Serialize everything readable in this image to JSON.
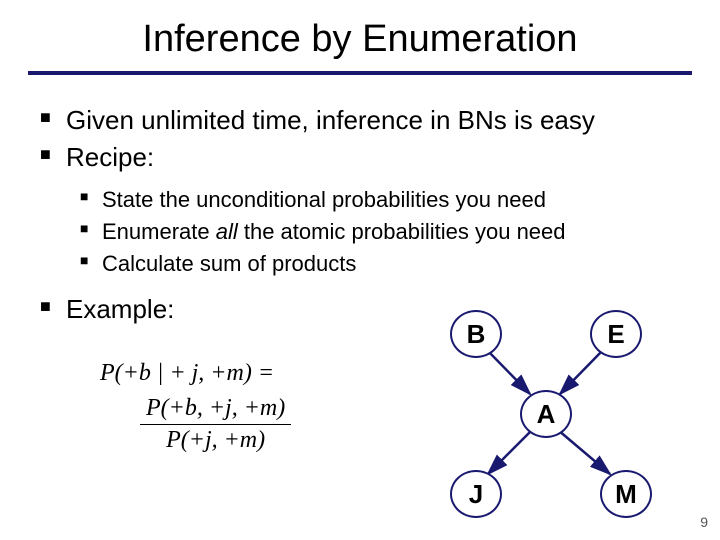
{
  "title": "Inference by Enumeration",
  "bullets": {
    "b1_1": "Given unlimited time, inference in BNs is easy",
    "b1_2": "Recipe:",
    "b2_1": "State the unconditional probabilities you need",
    "b2_2_pre": "Enumerate ",
    "b2_2_em": "all",
    "b2_2_post": " the atomic probabilities you need",
    "b2_3": "Calculate sum of products",
    "b1_3": "Example:"
  },
  "formula": {
    "lhs": "P(+b | + j, +m) =",
    "num": "P(+b, +j, +m)",
    "den": "P(+j, +m)"
  },
  "nodes": {
    "B": "B",
    "E": "E",
    "A": "A",
    "J": "J",
    "M": "M"
  },
  "page_number": "9"
}
